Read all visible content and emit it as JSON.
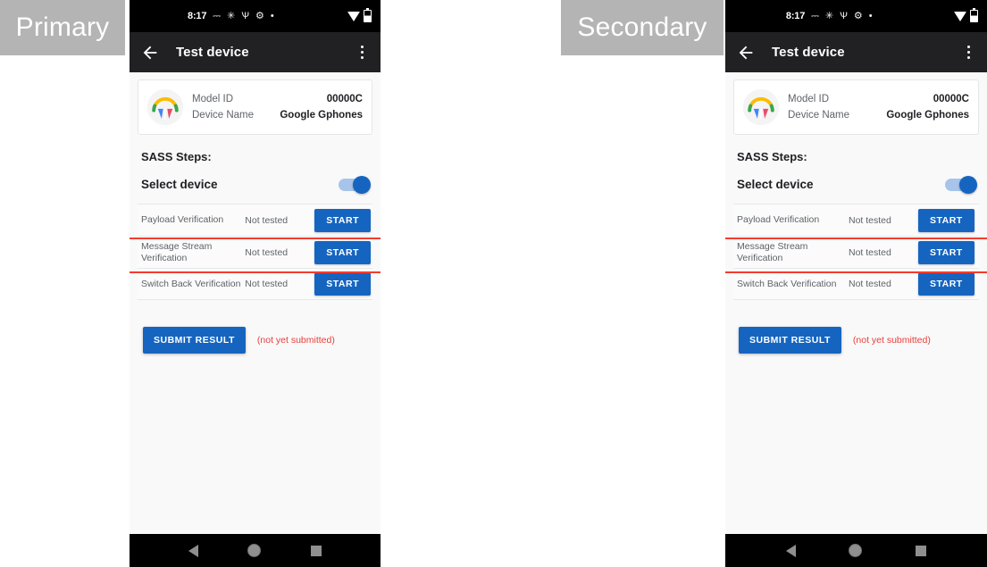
{
  "annotations": {
    "primary_label": "Primary",
    "secondary_label": "Secondary"
  },
  "colors": {
    "accent_blue": "#1565c0",
    "highlight_red": "#f43c2e",
    "note_red": "#e8403a",
    "status_bar": "#000000",
    "app_bar": "#212124",
    "label_bg": "#b4b4b4",
    "content_bg": "#f9f9f9"
  },
  "phone": {
    "status_bar": {
      "time": "8:17",
      "icons": [
        "sim-card-icon",
        "brightness-icon",
        "bluetooth-search-icon",
        "settings-gear-icon",
        "dot-icon"
      ],
      "right_icons": [
        "wifi-icon",
        "battery-icon"
      ]
    },
    "app_bar": {
      "back_icon": "back-arrow-icon",
      "title": "Test device",
      "overflow_icon": "kebab-menu-icon"
    },
    "device_card": {
      "icon": "pixel-buds-icon",
      "rows": [
        {
          "key": "Model ID",
          "value": "00000C"
        },
        {
          "key": "Device Name",
          "value": "Google Gphones"
        }
      ]
    },
    "steps_section": {
      "title": "SASS Steps:",
      "select_device": {
        "label": "Select device",
        "toggle_on": true
      },
      "rows": [
        {
          "name": "Payload Verification",
          "status": "Not tested",
          "action": "START",
          "highlighted": false
        },
        {
          "name": "Message Stream Verification",
          "status": "Not tested",
          "action": "START",
          "highlighted": false
        },
        {
          "name": "Switch Back Verification",
          "status": "Not tested",
          "action": "START",
          "highlighted": true
        }
      ]
    },
    "submit": {
      "button_label": "SUBMIT RESULT",
      "note": "(not yet submitted)"
    },
    "nav_bar": {
      "back": "nav-back-icon",
      "home": "nav-home-icon",
      "recents": "nav-recents-icon"
    }
  }
}
